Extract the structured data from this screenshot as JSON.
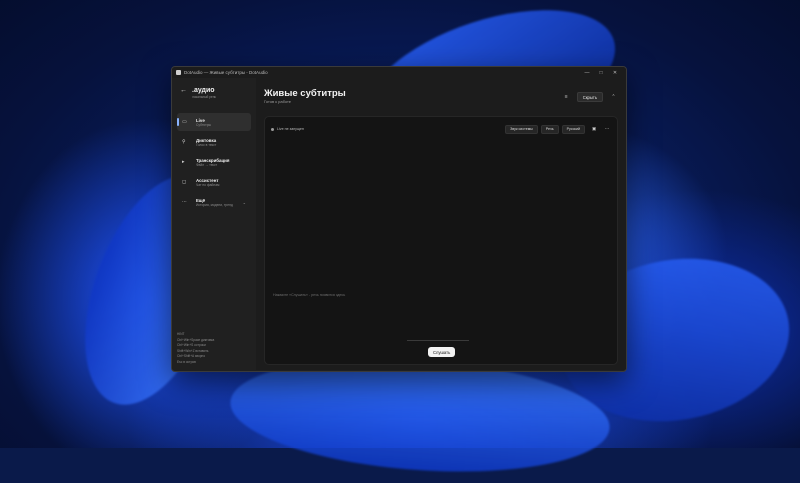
{
  "window": {
    "title": "DotAudio — Живые субтитры - DotAudio",
    "controls": {
      "minimize": "—",
      "maximize": "□",
      "close": "✕"
    }
  },
  "sidebar": {
    "brand_name": ".аудио",
    "brand_sub": "локальный ренк",
    "items": [
      {
        "label": "Live",
        "sub": "Субтитры",
        "icon": "live-caption-icon",
        "active": true
      },
      {
        "label": "Диктовка",
        "sub": "Голос в текст",
        "icon": "microphone-icon"
      },
      {
        "label": "Транскрибация",
        "sub": "Файл → текст",
        "icon": "file-audio-icon"
      },
      {
        "label": "Ассистент",
        "sub": "Чат по файлам",
        "icon": "chat-icon"
      },
      {
        "label": "Ещё",
        "sub": "История, модели, тренд",
        "icon": "more-icon",
        "expandable": true
      }
    ],
    "hotkeys": [
      "Ctrl+Win+Space диктовка",
      "Ctrl+Win+S остроки",
      "Shift+Win+Z вставить",
      "Ctrl+Shift+A зворно",
      "Esc в остров"
    ],
    "hotkeys_title": "HINT"
  },
  "main": {
    "title": "Живые субтитры",
    "subtitle": "Готов к работе",
    "hide_button": "Скрыть",
    "toolbar": {
      "status": "Live не запущен",
      "source_chip": "Звук системы",
      "mode_chip": "Речь",
      "language_chip": "Русский"
    },
    "hint": "Нажмите «Слушать» - речь появится здесь",
    "listen_button": "Слушать"
  }
}
